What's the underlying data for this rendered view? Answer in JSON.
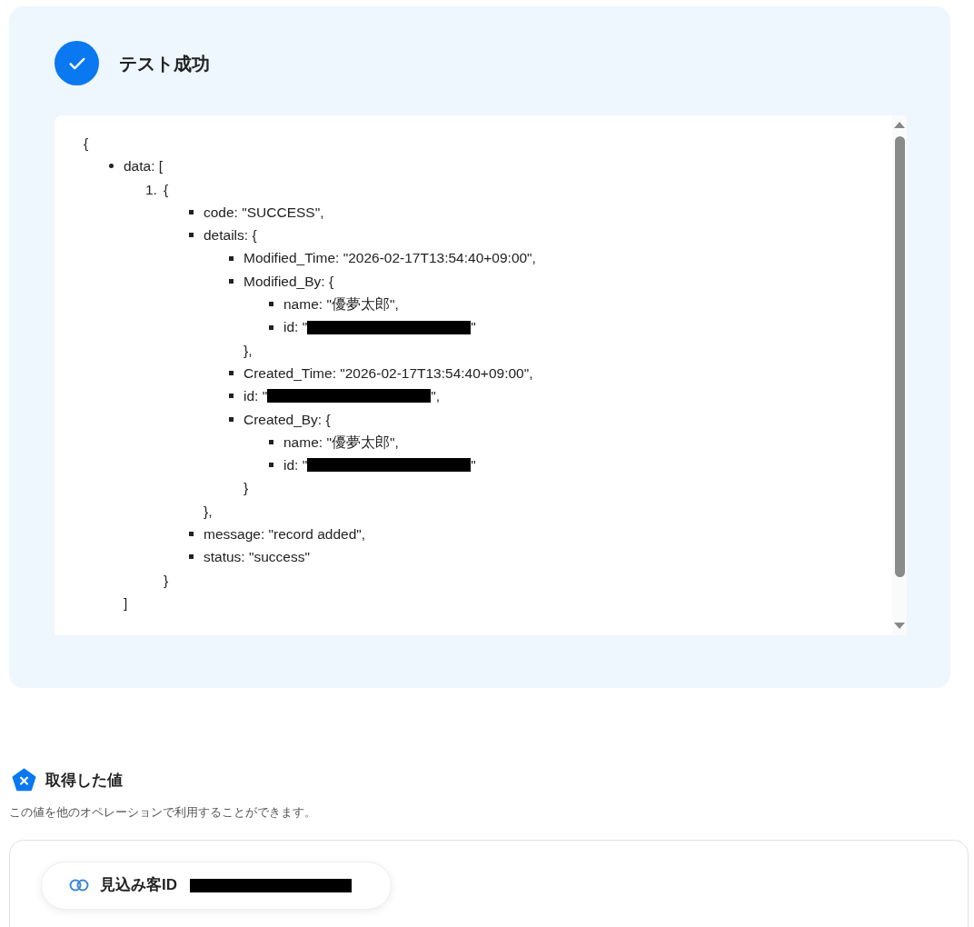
{
  "result_panel": {
    "title": "テスト成功",
    "json_view": {
      "open": "{",
      "items": [
        {
          "kind": "disc",
          "text": "data: [",
          "close": "]",
          "children": [
            {
              "kind": "numbered",
              "marker": "1.",
              "text": "{",
              "close": "}",
              "children": [
                {
                  "kind": "square",
                  "text": "code: \"SUCCESS\","
                },
                {
                  "kind": "square",
                  "text": "details: {",
                  "close": "},",
                  "children": [
                    {
                      "kind": "square",
                      "text": "Modified_Time: \"2026-02-17T13:54:40+09:00\","
                    },
                    {
                      "kind": "square",
                      "text": "Modified_By: {",
                      "close": "},",
                      "children": [
                        {
                          "kind": "square",
                          "text": "name: \"優夢太郎\","
                        },
                        {
                          "kind": "square",
                          "text": "id: \"",
                          "redacted": true,
                          "after": "\""
                        }
                      ]
                    },
                    {
                      "kind": "square",
                      "text": "Created_Time: \"2026-02-17T13:54:40+09:00\","
                    },
                    {
                      "kind": "square",
                      "text": "id: \"",
                      "redacted": true,
                      "after": "\","
                    },
                    {
                      "kind": "square",
                      "text": "Created_By: {",
                      "close": "}",
                      "children": [
                        {
                          "kind": "square",
                          "text": "name: \"優夢太郎\","
                        },
                        {
                          "kind": "square",
                          "text": "id: \"",
                          "redacted": true,
                          "after": "\""
                        }
                      ]
                    }
                  ]
                },
                {
                  "kind": "square",
                  "text": "message: \"record added\","
                },
                {
                  "kind": "square",
                  "text": "status: \"success\""
                }
              ]
            }
          ]
        }
      ]
    }
  },
  "values_section": {
    "title": "取得した値",
    "description": "この値を他のオペレーションで利用することができます。",
    "values": [
      {
        "label": "見込み客ID",
        "redacted": true
      }
    ]
  }
}
